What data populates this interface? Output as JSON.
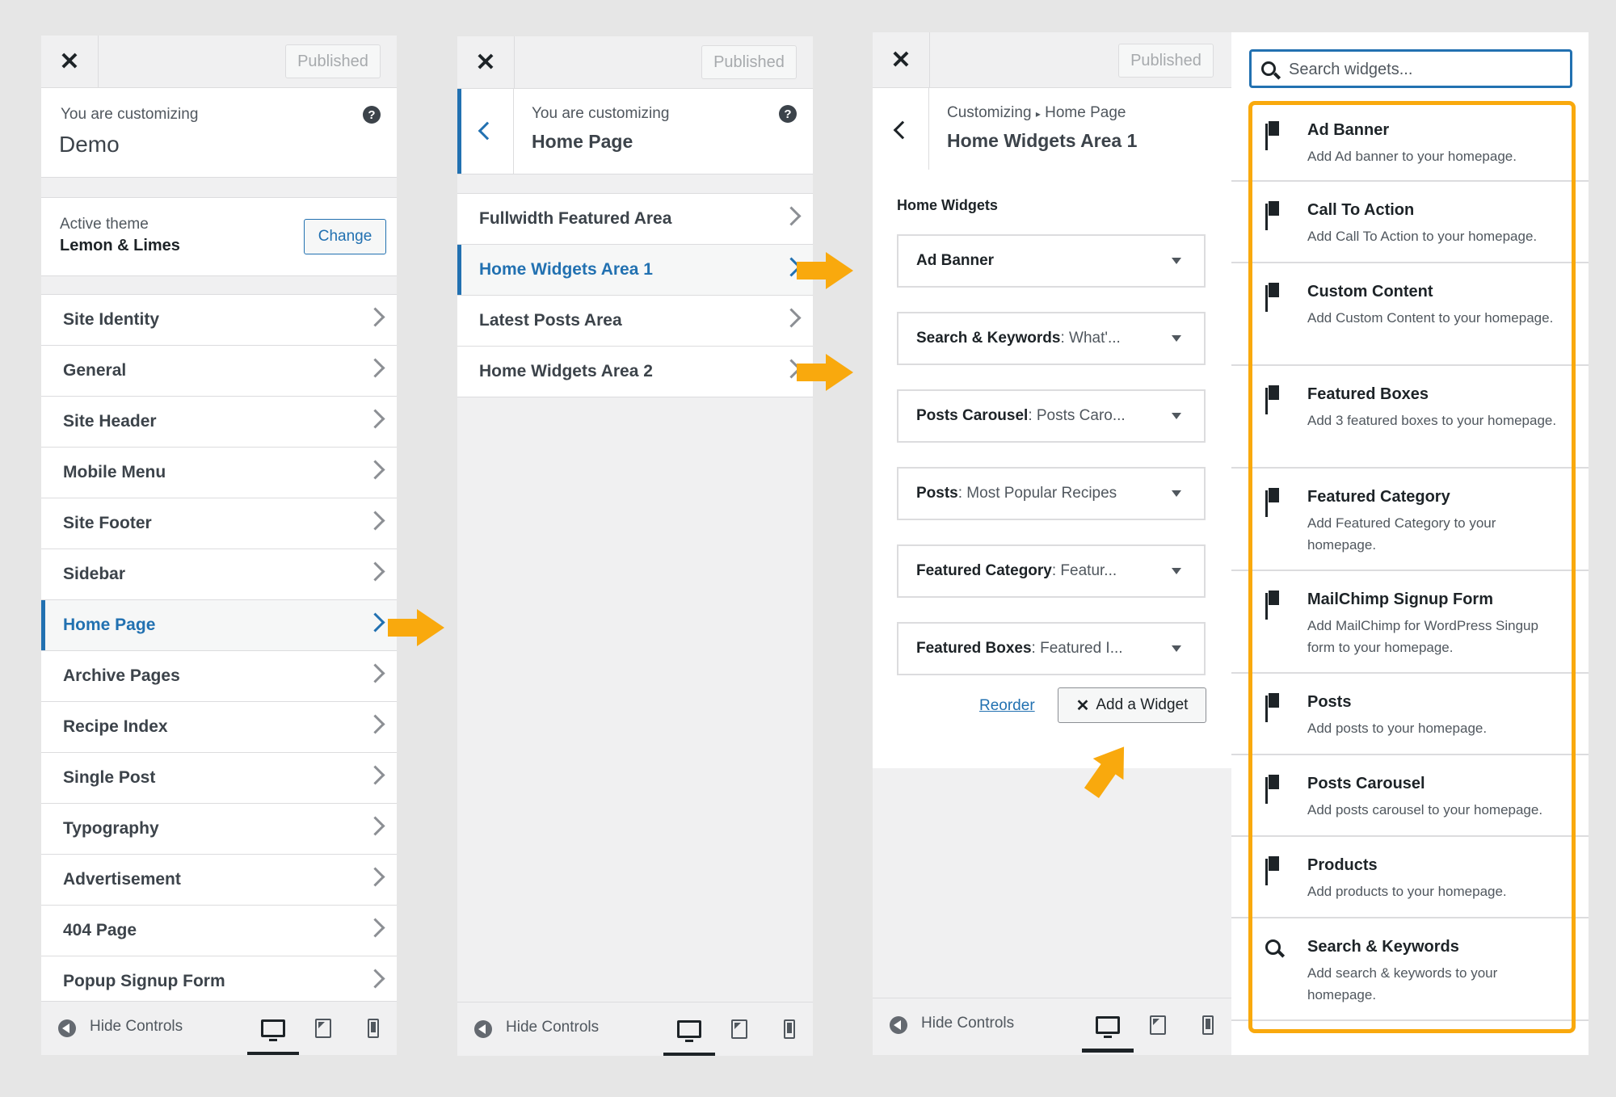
{
  "common": {
    "published_label": "Published",
    "hide_controls_label": "Hide Controls"
  },
  "panel1": {
    "customizing_label": "You are customizing",
    "site_name": "Demo",
    "active_theme_label": "Active theme",
    "theme_name": "Lemon & Limes",
    "change_label": "Change",
    "items": [
      {
        "label": "Site Identity"
      },
      {
        "label": "General"
      },
      {
        "label": "Site Header"
      },
      {
        "label": "Mobile Menu"
      },
      {
        "label": "Site Footer"
      },
      {
        "label": "Sidebar"
      },
      {
        "label": "Home Page"
      },
      {
        "label": "Archive Pages"
      },
      {
        "label": "Recipe Index"
      },
      {
        "label": "Single Post"
      },
      {
        "label": "Typography"
      },
      {
        "label": "Advertisement"
      },
      {
        "label": "404 Page"
      },
      {
        "label": "Popup Signup Form"
      }
    ]
  },
  "panel2": {
    "customizing_label": "You are customizing",
    "section_title": "Home Page",
    "items": [
      {
        "label": "Fullwidth Featured Area"
      },
      {
        "label": "Home Widgets Area 1"
      },
      {
        "label": "Latest Posts Area"
      },
      {
        "label": "Home Widgets Area 2"
      }
    ]
  },
  "panel3": {
    "breadcrumb_root": "Customizing",
    "breadcrumb_sep": "▸",
    "breadcrumb_parent": "Home Page",
    "section_title": "Home Widgets Area 1",
    "area_title": "Home Widgets",
    "widgets": [
      {
        "name": "Ad Banner",
        "title": ""
      },
      {
        "name": "Search & Keywords",
        "title": ": What'..."
      },
      {
        "name": "Posts Carousel",
        "title": ": Posts Caro..."
      },
      {
        "name": "Posts",
        "title": ": Most Popular Recipes"
      },
      {
        "name": "Featured Category",
        "title": ": Featur..."
      },
      {
        "name": "Featured Boxes",
        "title": ": Featured I..."
      }
    ],
    "reorder_label": "Reorder",
    "add_widget_icon": "✕",
    "add_widget_label": "Add a Widget"
  },
  "panel4": {
    "search_placeholder": "Search widgets...",
    "widgets": [
      {
        "title": "Ad Banner",
        "desc": "Add Ad banner to your homepage.",
        "icon": "copy-icon"
      },
      {
        "title": "Call To Action",
        "desc": "Add Call To Action to your homepage.",
        "icon": "copy-icon"
      },
      {
        "title": "Custom Content",
        "desc": "Add Custom Content to your homepage.",
        "icon": "copy-icon"
      },
      {
        "title": "Featured Boxes",
        "desc": "Add 3 featured boxes to your homepage.",
        "icon": "copy-icon"
      },
      {
        "title": "Featured Category",
        "desc": "Add Featured Category to your homepage.",
        "icon": "copy-icon"
      },
      {
        "title": "MailChimp Signup Form",
        "desc": "Add MailChimp for WordPress Singup form to your homepage.",
        "icon": "copy-icon"
      },
      {
        "title": "Posts",
        "desc": "Add posts to your homepage.",
        "icon": "copy-icon"
      },
      {
        "title": "Posts Carousel",
        "desc": "Add posts carousel to your homepage.",
        "icon": "copy-icon"
      },
      {
        "title": "Products",
        "desc": "Add products to your homepage.",
        "icon": "copy-icon"
      },
      {
        "title": "Search & Keywords",
        "desc": "Add search & keywords to your homepage.",
        "icon": "search-icon"
      }
    ]
  },
  "colors": {
    "accent": "#2271b1",
    "highlight": "#f9a90d"
  }
}
